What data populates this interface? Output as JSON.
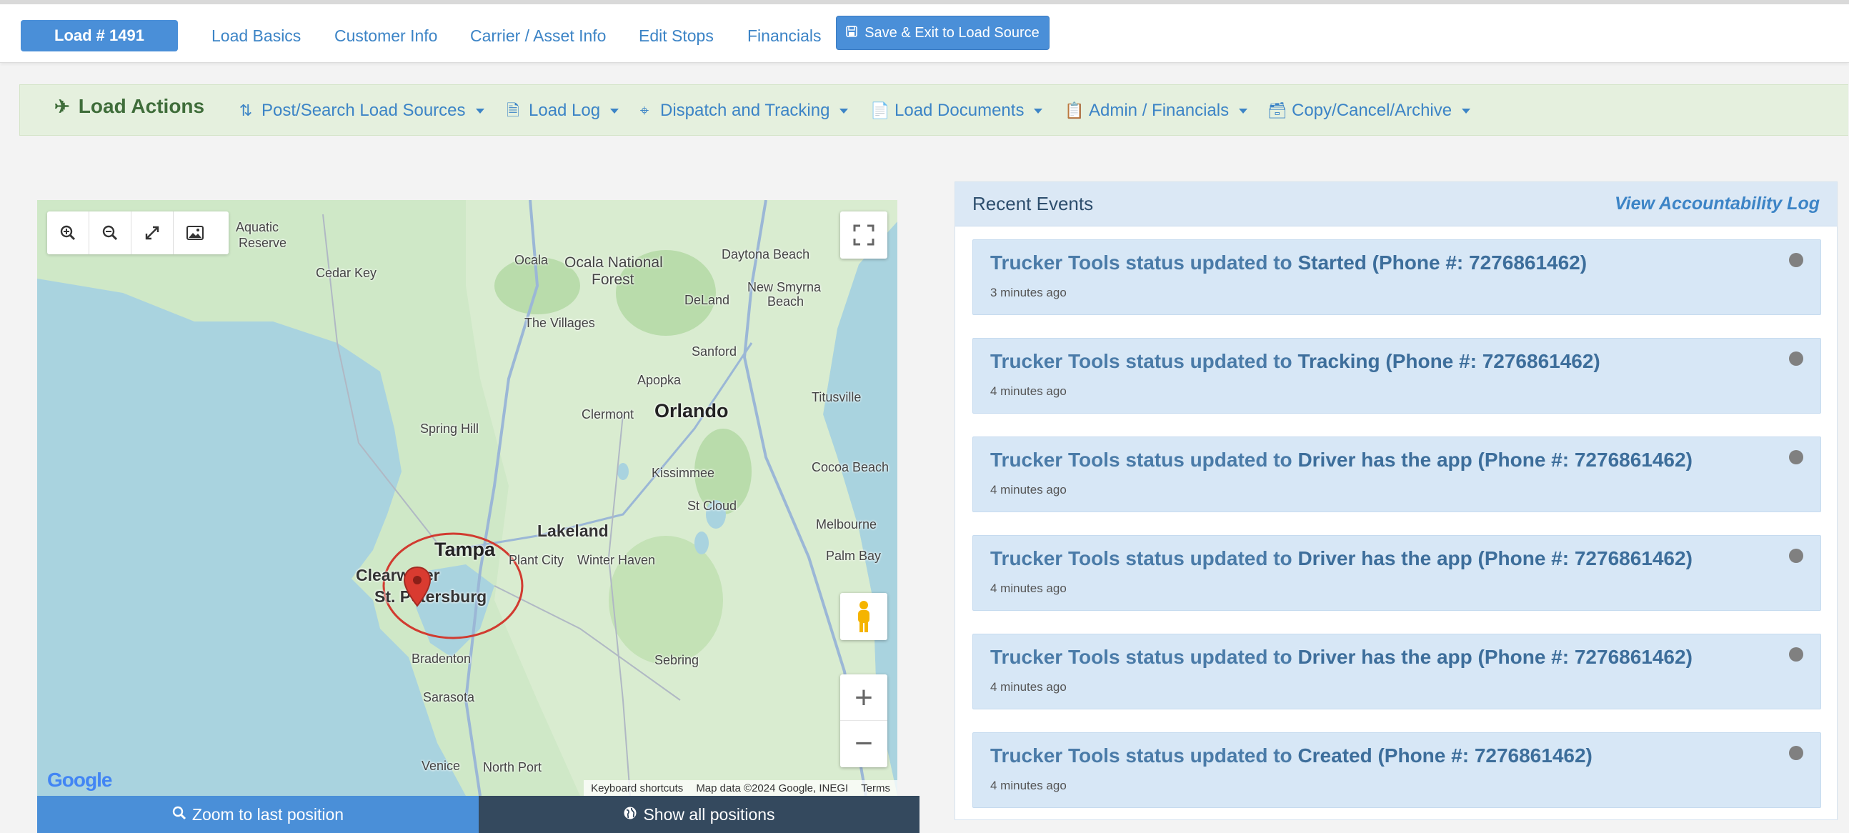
{
  "topbar": {
    "load_badge": "Load # 1491",
    "nav": [
      "Load Basics",
      "Customer Info",
      "Carrier / Asset Info",
      "Edit Stops",
      "Financials"
    ],
    "save_label": "Save & Exit to Load Source"
  },
  "actions": {
    "title": "Load Actions",
    "items": [
      {
        "label": "Post/Search Load Sources",
        "icon": "retweet-icon"
      },
      {
        "label": "Load Log",
        "icon": "file-search-icon"
      },
      {
        "label": "Dispatch and Tracking",
        "icon": "crosshairs-icon"
      },
      {
        "label": "Load Documents",
        "icon": "document-icon"
      },
      {
        "label": "Admin / Financials",
        "icon": "copy-documents-icon"
      },
      {
        "label": "Copy/Cancel/Archive",
        "icon": "archive-icon"
      }
    ]
  },
  "map": {
    "labels": {
      "aquatic": "Aquatic",
      "reserve": "Reserve",
      "cedar_key": "Cedar Key",
      "ocala": "Ocala",
      "ocala_forest": "Ocala National",
      "forest": "Forest",
      "daytona": "Daytona Beach",
      "new_smyrna": "New Smyrna",
      "beach": "Beach",
      "deland": "DeLand",
      "villages": "The Villages",
      "sanford": "Sanford",
      "apopka": "Apopka",
      "titusville": "Titusville",
      "spring_hill": "Spring Hill",
      "clermont": "Clermont",
      "orlando": "Orlando",
      "kissimmee": "Kissimmee",
      "cocoa": "Cocoa Beach",
      "st_cloud": "St Cloud",
      "melbourne": "Melbourne",
      "lakeland": "Lakeland",
      "tampa": "Tampa",
      "palm_bay": "Palm Bay",
      "plant_city": "Plant City",
      "winter_haven": "Winter Haven",
      "clearwater": "Clearwater",
      "st_pete": "St. Petersburg",
      "bradenton": "Bradenton",
      "sebring": "Sebring",
      "sarasota": "Sarasota",
      "venice": "Venice",
      "north_port": "North Port"
    },
    "footer": {
      "shortcuts": "Keyboard shortcuts",
      "data": "Map data ©2024 Google, INEGI",
      "terms": "Terms"
    },
    "logo": "Google",
    "zoom_last": "Zoom to last position",
    "show_all": "Show all positions"
  },
  "events": {
    "title": "Recent Events",
    "link": "View Accountability Log",
    "prefix": "Trucker Tools status updated to",
    "items": [
      {
        "status": "Started (Phone #: 7276861462)",
        "time": "3 minutes ago"
      },
      {
        "status": "Tracking (Phone #: 7276861462)",
        "time": "4 minutes ago"
      },
      {
        "status": "Driver has the app (Phone #: 7276861462)",
        "time": "4 minutes ago"
      },
      {
        "status": "Driver has the app (Phone #: 7276861462)",
        "time": "4 minutes ago"
      },
      {
        "status": "Driver has the app (Phone #: 7276861462)",
        "time": "4 minutes ago"
      },
      {
        "status": "Created (Phone #: 7276861462)",
        "time": "4 minutes ago"
      }
    ]
  },
  "colors": {
    "primary": "#4a8fd8",
    "dark": "#34495e",
    "actions_bg": "#e5f0de",
    "event_bg": "#d7e7f6",
    "marker": "#d93b30"
  }
}
